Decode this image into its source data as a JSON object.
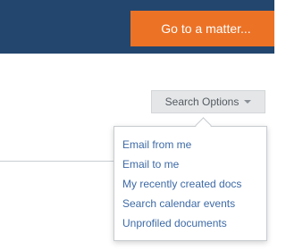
{
  "header": {
    "goto_button_label": "Go to a matter..."
  },
  "search_options": {
    "button_label": "Search Options",
    "menu_items": [
      "Email from me",
      "Email to me",
      "My recently created docs",
      "Search calendar events",
      "Unprofiled documents"
    ]
  },
  "colors": {
    "header_bg": "#23466e",
    "accent": "#ec7226",
    "link": "#3d6aa6"
  }
}
